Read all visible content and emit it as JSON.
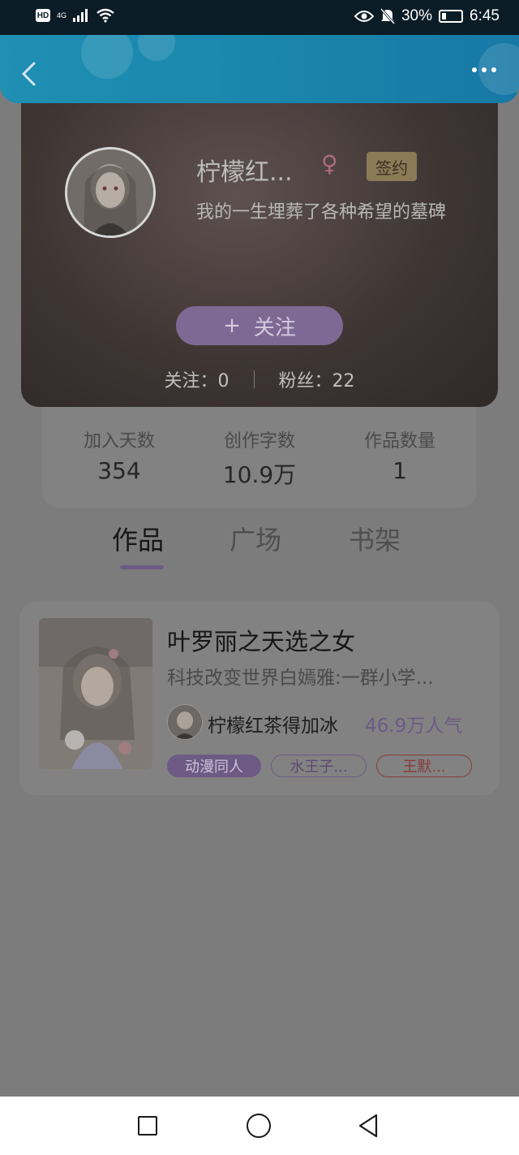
{
  "status_bar": {
    "hd": "HD",
    "network": "4G",
    "battery": "30%",
    "time": "6:45"
  },
  "header": {
    "back_icon": "chevron-left-icon",
    "more_icon": "more-dots-icon",
    "accent_color": "#1a86ad"
  },
  "profile": {
    "username": "柠檬红...",
    "gender_icon": "female-icon",
    "badge": "签约",
    "bio": "我的一生埋葬了各种希望的墓碑",
    "follow_button": "关注",
    "follow_icon": "plus-icon",
    "following_label": "关注：",
    "following_count": "0",
    "fans_label": "粉丝：",
    "fans_count": "22"
  },
  "stats": [
    {
      "label": "加入天数",
      "value": "354"
    },
    {
      "label": "创作字数",
      "value": "10.9万"
    },
    {
      "label": "作品数量",
      "value": "1"
    }
  ],
  "tabs": [
    {
      "label": "作品",
      "active": true
    },
    {
      "label": "广场",
      "active": false
    },
    {
      "label": "书架",
      "active": false
    }
  ],
  "work": {
    "title": "叶罗丽之天选之女",
    "description": "科技改变世界白嫣雅:一群小学...",
    "author": "柠檬红茶得加冰",
    "popularity": "46.9万人气",
    "tags": [
      "动漫同人",
      "水王子...",
      "王默..."
    ],
    "accent_color": "#9b7fc0"
  },
  "nav": {
    "recent_icon": "square-icon",
    "home_icon": "circle-icon",
    "back_icon": "triangle-back-icon"
  }
}
